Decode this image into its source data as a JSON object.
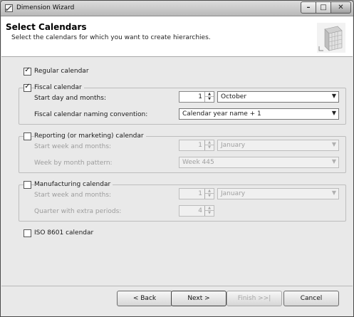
{
  "window": {
    "title": "Dimension Wizard"
  },
  "header": {
    "title": "Select Calendars",
    "subtitle": "Select the calendars for which you want to create hierarchies."
  },
  "regular": {
    "label": "Regular calendar",
    "checked": true
  },
  "fiscal": {
    "label": "Fiscal calendar",
    "checked": true,
    "start_label": "Start day and months:",
    "start_value": "1",
    "month_value": "October",
    "naming_label": "Fiscal calendar naming convention:",
    "naming_value": "Calendar year name + 1"
  },
  "reporting": {
    "label": "Reporting (or marketing) calendar",
    "checked": false,
    "start_label": "Start week and months:",
    "start_value": "1",
    "month_value": "January",
    "pattern_label": "Week by month pattern:",
    "pattern_value": "Week 445"
  },
  "manufacturing": {
    "label": "Manufacturing calendar",
    "checked": false,
    "start_label": "Start week and months:",
    "start_value": "1",
    "month_value": "January",
    "quarter_label": "Quarter with extra periods:",
    "quarter_value": "4"
  },
  "iso": {
    "label": "ISO 8601 calendar",
    "checked": false
  },
  "buttons": {
    "back": "< Back",
    "next": "Next >",
    "finish": "Finish >>|",
    "cancel": "Cancel"
  },
  "icons": {
    "check": "✓",
    "arrow_down": "▼",
    "arrow_up_small": "▲",
    "arrow_down_small": "▼",
    "minimize": "–",
    "maximize": "□",
    "close": "✕"
  }
}
